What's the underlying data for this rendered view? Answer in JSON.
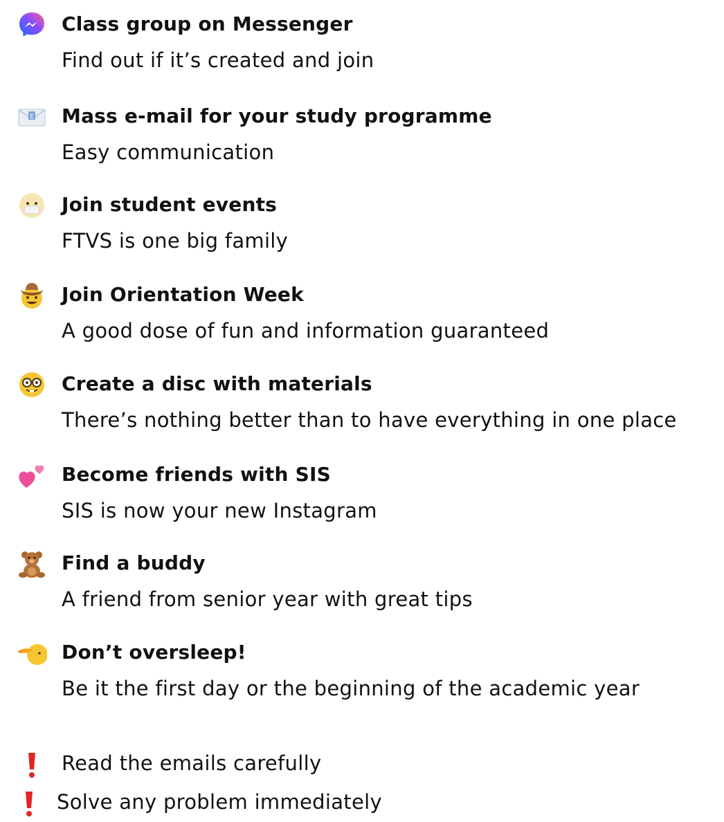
{
  "items": [
    {
      "title": "Class group on Messenger",
      "subtitle": "Find out if it’s created and join",
      "icon": "messenger-icon"
    },
    {
      "title": "Mass e-mail for your study programme",
      "subtitle": "Easy communication",
      "icon": "envelope-icon"
    },
    {
      "title": "Join student events",
      "subtitle": "FTVS is one big family",
      "icon": "masked-face-icon"
    },
    {
      "title": "Join Orientation Week",
      "subtitle": "A good dose of fun and information guaranteed",
      "icon": "cowboy-face-icon"
    },
    {
      "title": "Create a disc with materials",
      "subtitle": "There’s nothing better than to have everything in one place",
      "icon": "nerd-face-icon"
    },
    {
      "title": "Become friends with SIS",
      "subtitle": "SIS is now your new Instagram",
      "icon": "two-hearts-icon"
    },
    {
      "title": "Find a buddy",
      "subtitle": "A friend from senior year with great tips",
      "icon": "teddy-bear-icon"
    },
    {
      "title": "Don’t oversleep!",
      "subtitle": "Be it the first day or the beginning of the academic year",
      "icon": "pointing-face-icon"
    }
  ],
  "notes": [
    {
      "text": "Read the emails carefully",
      "icon": "exclamation-icon"
    },
    {
      "text": "Solve any problem immediately",
      "icon": "exclamation-icon"
    }
  ],
  "colors": {
    "text": "#111111",
    "messenger_gradient_start": "#2f7bff",
    "messenger_gradient_end": "#c43dff",
    "emoji_yellow": "#f7c531",
    "heart_pink": "#ef4f9a",
    "teddy_brown": "#b5733a",
    "exclamation_red": "#e02626"
  }
}
